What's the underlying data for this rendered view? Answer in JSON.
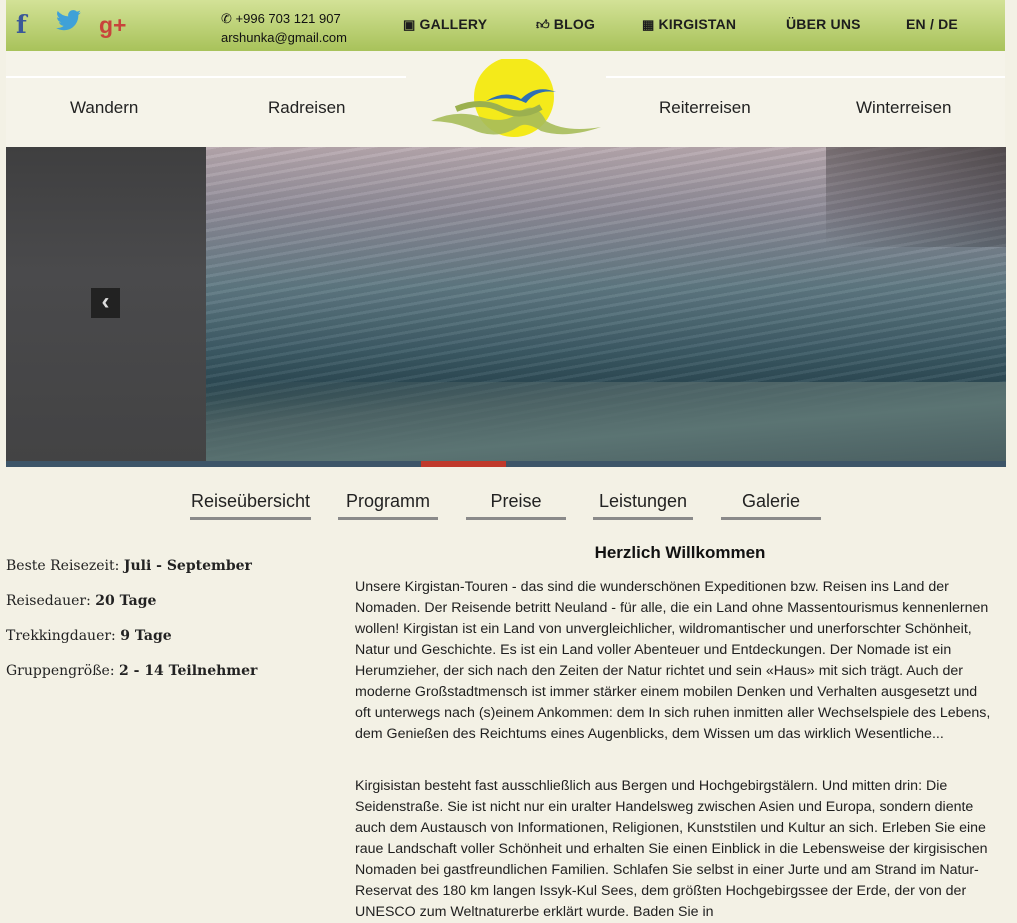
{
  "social": {
    "facebook": "f",
    "twitter": "🐦",
    "googleplus": "g+"
  },
  "contact": {
    "phone": "+996 703 121 907",
    "email": "arshunka@gmail.com"
  },
  "topnav": [
    {
      "label": "GALLERY",
      "icon": "image-icon"
    },
    {
      "label": "BLOG",
      "icon": "thumbs-up-icon"
    },
    {
      "label": "KIRGISTAN",
      "icon": "table-icon"
    },
    {
      "label": "ÜBER UNS",
      "icon": ""
    }
  ],
  "language": "EN / DE",
  "mainnav": [
    "Wandern",
    "Radreisen",
    "Reiterreisen",
    "Winterreisen"
  ],
  "tabs": [
    "Reiseübersicht",
    "Programm",
    "Preise",
    "Leistungen",
    "Galerie"
  ],
  "facts": [
    {
      "label": "Beste Reisezeit: ",
      "value": "Juli - September"
    },
    {
      "label": "Reisedauer: ",
      "value": "20 Tage"
    },
    {
      "label": "Trekkingdauer: ",
      "value": "9 Tage"
    },
    {
      "label": "Gruppengröße: ",
      "value": "2 - 14 Teilnehmer"
    }
  ],
  "welcome": {
    "title": "Herzlich Willkommen",
    "p1": "Unsere Kirgistan-Touren - das sind die wunderschönen Expeditionen bzw. Reisen ins Land der Nomaden. Der Reisende betritt Neuland - für alle, die ein Land ohne Massentourismus kennenlernen wollen! Kirgistan ist ein Land von unvergleichlicher, wildromantischer und unerforschter Schönheit, Natur und Geschichte. Es ist ein Land voller Abenteuer und Entdeckungen. Der Nomade ist ein Herumzieher, der sich nach den Zeiten der Natur richtet und sein «Haus» mit sich trägt. Auch der moderne Großstadtmensch ist immer stärker einem mobilen Denken und Verhalten ausgesetzt und oft unterwegs nach (s)einem Ankommen: dem In sich ruhen inmitten aller Wechselspiele des Lebens, dem Genießen des Reichtums eines Augenblicks, dem Wissen um das wirklich Wesentliche...",
    "p2": "Kirgisistan besteht fast ausschließlich aus Bergen und Hochgebirgstälern. Und mitten drin: Die Seidenstraße. Sie ist nicht nur ein uralter Handelsweg zwischen Asien und Europa, sondern diente auch dem Austausch von Informationen, Religionen, Kunststilen und Kultur an sich. Erleben Sie eine raue Landschaft voller Schönheit und erhalten Sie einen Einblick in die Lebensweise der kirgisischen Nomaden bei gastfreundlichen Familien. Schlafen Sie selbst in einer Jurte und am Strand im Natur-Reservat des 180 km langen Issyk-Kul Sees, dem größten Hochgebirgssee der Erde, der von der UNESCO zum Weltnaturerbe erklärt wurde. Baden Sie in"
  },
  "slider": {
    "prev_arrow": "‹"
  },
  "colors": {
    "topbar": "#b9cf6f",
    "progress_fill": "#c0392b",
    "background": "#f3f1e5"
  }
}
